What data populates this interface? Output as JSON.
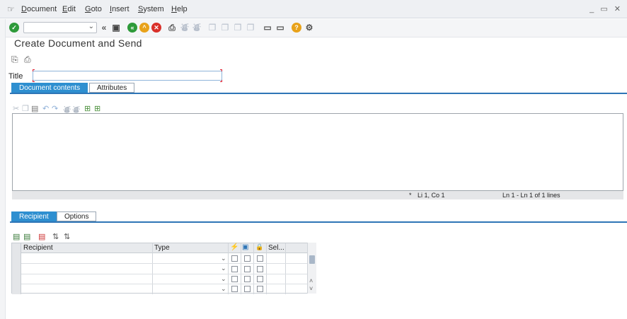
{
  "menu": {
    "items": [
      {
        "label": "Document",
        "u": "D",
        "rest": "ocument"
      },
      {
        "label": "Edit",
        "u": "E",
        "rest": "dit"
      },
      {
        "label": "Goto",
        "u": "G",
        "rest": "oto"
      },
      {
        "label": "Insert",
        "u": "I",
        "rest": "nsert"
      },
      {
        "label": "System",
        "u": "S",
        "rest": "ystem"
      },
      {
        "label": "Help",
        "u": "H",
        "rest": "elp"
      }
    ],
    "window_controls": "_ ▭ ✕"
  },
  "toolbar": {
    "command_field": "",
    "icons": [
      "enter-icon",
      "back-icon",
      "save-icon",
      "back-green-icon",
      "exit-icon",
      "cancel-icon",
      "print-icon",
      "find-icon",
      "find-next-icon",
      "first-page-icon",
      "prev-page-icon",
      "next-page-icon",
      "last-page-icon",
      "new-session-icon",
      "shortcut-icon",
      "help-icon",
      "settings-icon"
    ]
  },
  "page": {
    "title": "Create Document and Send"
  },
  "document": {
    "title_label": "Title",
    "title_value": "",
    "tabs": [
      "Document contents",
      "Attributes"
    ],
    "active_tab": "Document contents",
    "editor_text": "",
    "status_mark": "*",
    "cursor_position": "Li 1, Co 1",
    "line_info": "Ln 1 - Ln 1 of 1 lines"
  },
  "recipients": {
    "tabs": [
      "Recipient",
      "Options"
    ],
    "active_tab": "Recipient",
    "columns": {
      "recipient": "Recipient",
      "type": "Type",
      "express": "⚡",
      "copy": "▣",
      "lock": "🔒",
      "selection": "Sel..."
    },
    "rows": [
      {
        "recipient": "",
        "type": ""
      },
      {
        "recipient": "",
        "type": ""
      },
      {
        "recipient": "",
        "type": ""
      },
      {
        "recipient": "",
        "type": ""
      }
    ]
  },
  "colors": {
    "accent": "#2e8fd0",
    "tab_line": "#2e75b6",
    "green": "#2e9a3a",
    "orange": "#e8a21a",
    "red": "#d9302a"
  }
}
